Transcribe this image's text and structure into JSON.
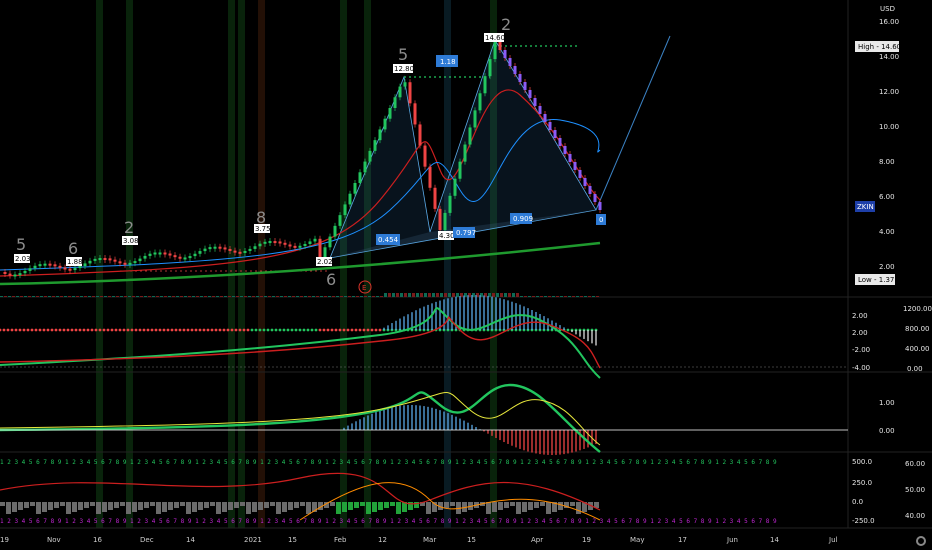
{
  "currency": "USD",
  "price_axis": [
    "16.00",
    "14.00",
    "12.00",
    "10.00",
    "8.00",
    "6.00",
    "4.00",
    "2.00"
  ],
  "high_label": "High - 14.60",
  "low_label": "Low - 1.37",
  "ticker_tag": "ZKIN",
  "price_tags": {
    "t203": "2.03",
    "t188": "1.88",
    "t308": "3.08",
    "t375": "3.75",
    "t202": "2.02",
    "t1280": "12.80",
    "t1460": "14.60",
    "t118": "1.18",
    "t454": "0.454",
    "t430": "4.30",
    "t797": "0.797",
    "t909": "0.909",
    "t0": "0"
  },
  "wave_labels": [
    "5",
    "6",
    "2",
    "8",
    "5",
    "2",
    "6"
  ],
  "earnings_marker": "E",
  "osc1_axis": [
    "2.00",
    "0.00",
    "-2.00",
    "-4.00"
  ],
  "osc1_axis_right": [
    "1200.00",
    "800.00",
    "400.00",
    "0.00"
  ],
  "osc2_axis": [
    "1.00",
    "0.00"
  ],
  "osc3_axis_left": [
    "500.0",
    "250.0",
    "0.0",
    "-250.0"
  ],
  "osc3_axis_right": [
    "60.00",
    "50.00",
    "40.00"
  ],
  "time_axis": [
    "19",
    "Nov",
    "16",
    "Dec",
    "14",
    "2021",
    "15",
    "Feb",
    "12",
    "Mar",
    "15",
    "Apr",
    "19",
    "May",
    "17",
    "Jun",
    "14",
    "Jul"
  ],
  "digit_row": "1 2 3 4 5 6 7 8 9 ",
  "colors": {
    "bull": "#22c55e",
    "bear": "#ef4444",
    "accent": "#2e7bd6",
    "trend_red": "#cc1f1f",
    "trend_green": "#1f9a2e"
  }
}
